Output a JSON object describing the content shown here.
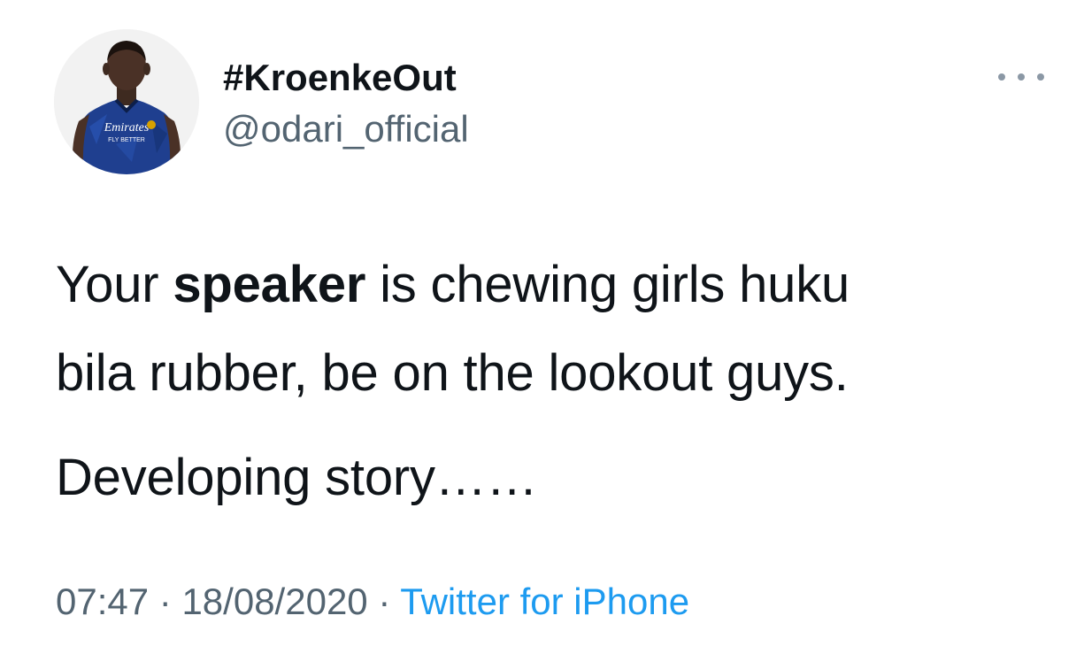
{
  "user": {
    "display_name": "#KroenkeOut",
    "handle": "@odari_official",
    "avatar": {
      "icon": "profile-photo",
      "shirt_text": "Emirates",
      "shirt_subtext": "FLY BETTER",
      "shirt_color": "#1f3f8f"
    }
  },
  "tweet": {
    "line1_prefix": "Your ",
    "line1_bold": "speaker",
    "line1_suffix": " is chewing girls huku",
    "line2": "bila rubber, be on the lookout guys.",
    "line3": "Developing story……"
  },
  "meta": {
    "time": "07:47",
    "separator": "·",
    "date": "18/08/2020",
    "source": "Twitter for iPhone"
  },
  "colors": {
    "primary_text": "#0f1419",
    "secondary_text": "#536471",
    "link": "#1d9bf0"
  }
}
